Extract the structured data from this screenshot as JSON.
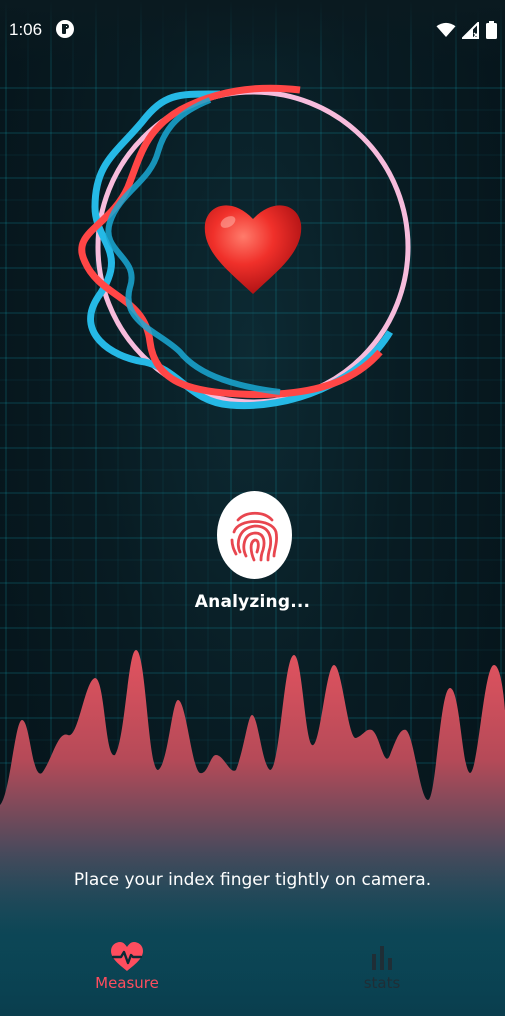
{
  "status_bar": {
    "time": "1:06",
    "icons": [
      "app-notification-icon",
      "wifi-icon",
      "cellular-signal-icon",
      "battery-icon"
    ]
  },
  "colors": {
    "accent": "#ff4d5e",
    "ring_pink": "#f4b8d8",
    "ring_cyan": "#25b9e6",
    "ring_red": "#ff4b4b",
    "wave_top": "#e0525e",
    "background": "#081b22"
  },
  "main": {
    "status_text": "Analyzing...",
    "instruction": "Place your index finger tightly on camera."
  },
  "bottom_nav": {
    "items": [
      {
        "label": "Measure",
        "icon": "heart-pulse-icon",
        "active": true
      },
      {
        "label": "stats",
        "icon": "bar-chart-icon",
        "active": false
      }
    ]
  }
}
